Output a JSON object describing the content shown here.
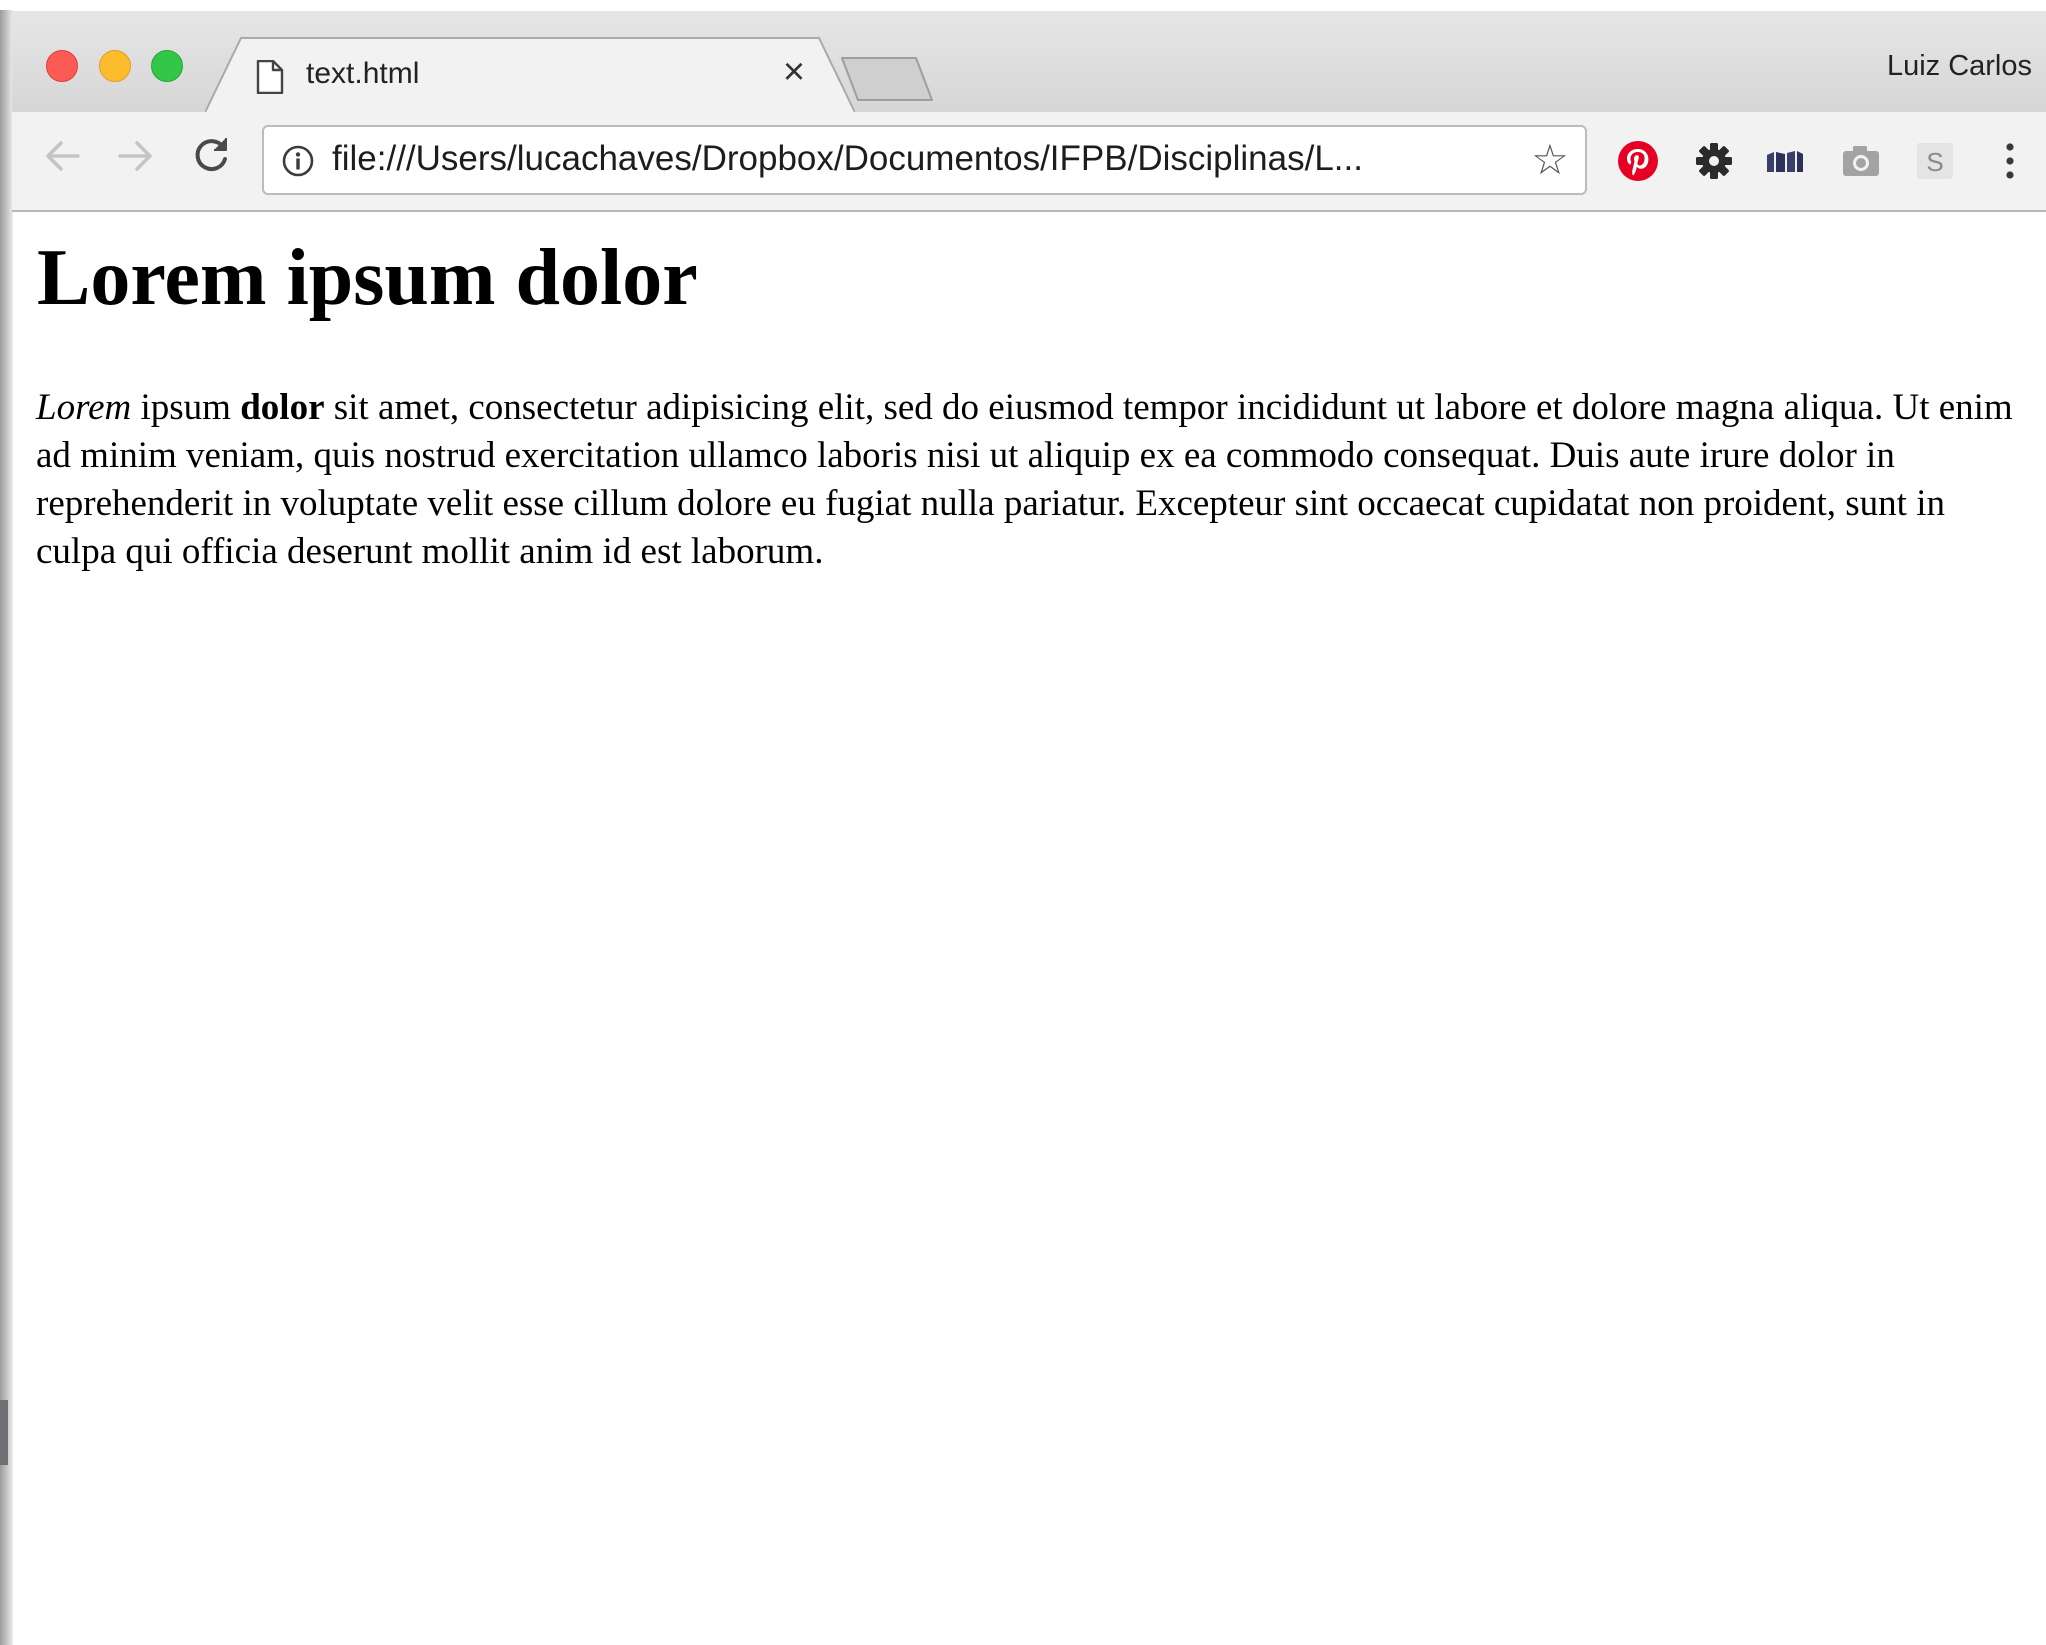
{
  "browser": {
    "tab": {
      "title": "text.html",
      "close_glyph": "×"
    },
    "profile_name": "Luiz Carlos",
    "address_bar": {
      "url": "file:///Users/lucachaves/Dropbox/Documentos/IFPB/Disciplinas/L..."
    },
    "toolbar": {
      "back_icon": "arrow-left-icon",
      "forward_icon": "arrow-right-icon",
      "reload_icon": "reload-icon",
      "bookmark_glyph": "☆"
    },
    "extensions": [
      {
        "name": "pinterest-icon",
        "color": "#e60023"
      },
      {
        "name": "gear-icon",
        "color": "#2b2b2b"
      },
      {
        "name": "books-icon",
        "color": "#3a3f6b"
      },
      {
        "name": "camera-icon",
        "color": "#9a9a9a"
      },
      {
        "name": "s-extension-icon",
        "letter": "S",
        "color": "#9a9a9a"
      }
    ]
  },
  "page": {
    "heading": "Lorem ipsum dolor",
    "paragraph": {
      "italic": "Lorem",
      "after_italic": " ipsum ",
      "bold": "dolor",
      "rest": " sit amet, consectetur adipisicing elit, sed do eiusmod tempor incididunt ut labore et dolore magna aliqua. Ut enim ad minim veniam, quis nostrud exercitation ullamco laboris nisi ut aliquip ex ea commodo consequat. Duis aute irure dolor in reprehenderit in voluptate velit esse cillum dolore eu fugiat nulla pariatur. Excepteur sint occaecat cupidatat non proident, sunt in culpa qui officia deserunt mollit anim id est laborum."
    }
  }
}
